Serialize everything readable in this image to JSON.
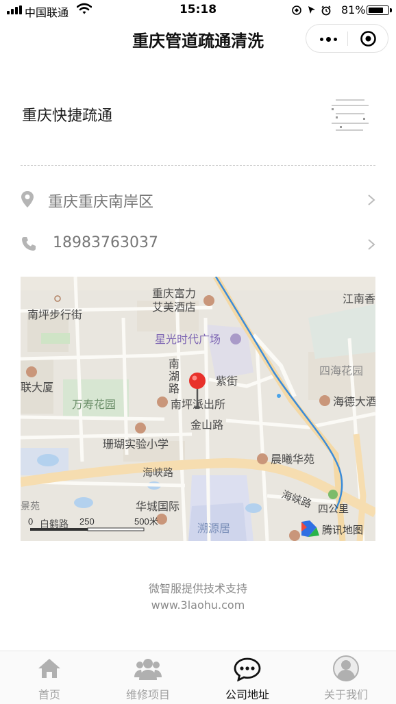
{
  "status_bar": {
    "carrier": "中国联通",
    "time": "15:18",
    "battery_percent": "81%",
    "battery_level": 0.81
  },
  "nav": {
    "title": "重庆管道疏通清洗"
  },
  "company": {
    "name": "重庆快捷疏通"
  },
  "contact": {
    "address": "重庆重庆南岸区",
    "phone": "18983763037"
  },
  "map": {
    "labels": {
      "nanping_buxingjie": "南坪步行街",
      "fuli_1": "重庆富力",
      "fuli_2": "艾美酒店",
      "jiangnan": "江南香",
      "xingguang": "星光时代广场",
      "nanhu_road_1": "南",
      "nanhu_road_2": "湖",
      "nanhu_road_3": "路",
      "zijie": "紫街",
      "sihai": "四海花园",
      "lian_dasha": "联大厦",
      "wanshou": "万寿花园",
      "paichusuo": "南坪派出所",
      "haide": "海德大酒",
      "jinshan": "金山路",
      "shanhu": "珊瑚实验小学",
      "chenxi": "晨曦华苑",
      "haixia_1": "海峡路",
      "haixia_2": "海峡路",
      "sigongli": "四公里",
      "huacheng": "华城国际",
      "suyuanju": "溯源居",
      "baihe": "白鹤路",
      "tencent": "腾讯地图",
      "scale_0": "0",
      "scale_250": "250",
      "scale_500": "500米",
      "left_edge": "景苑"
    }
  },
  "footer": {
    "support_text": "微智服提供技术支持",
    "support_url": "www.3laohu.com"
  },
  "tabs": [
    {
      "label": "首页",
      "icon": "home-icon",
      "active": false
    },
    {
      "label": "维修项目",
      "icon": "people-icon",
      "active": false
    },
    {
      "label": "公司地址",
      "icon": "chat-bubble-icon",
      "active": true
    },
    {
      "label": "关于我们",
      "icon": "user-icon",
      "active": false
    }
  ],
  "colors": {
    "map_background": "#e9e6df",
    "major_road": "#f6ddb0",
    "metro_line": "#3b8bd8",
    "marker": "#e8312b",
    "active_tab": "#111111",
    "inactive_tab": "#a0a0a0"
  }
}
